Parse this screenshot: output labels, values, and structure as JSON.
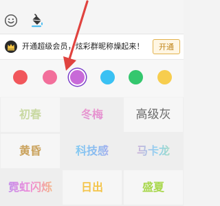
{
  "toolbar": {
    "icons": [
      "emoji-icon",
      "paint-bucket-icon"
    ]
  },
  "banner": {
    "text": "开通超级会员，炫彩群昵称燥起来！",
    "button_label": "开通"
  },
  "swatches": [
    {
      "name": "red",
      "color": "#f1575c",
      "selected": false
    },
    {
      "name": "pink",
      "color": "#f26f9b",
      "selected": false
    },
    {
      "name": "purple",
      "color": "#c86ad8",
      "selected": true
    },
    {
      "name": "blue",
      "color": "#3ac1f3",
      "selected": false
    },
    {
      "name": "green",
      "color": "#34c76e",
      "selected": false
    },
    {
      "name": "yellow",
      "color": "#f7cd4e",
      "selected": false
    }
  ],
  "styles": [
    {
      "label": "初春"
    },
    {
      "label": "冬梅"
    },
    {
      "label": "高级灰"
    },
    {
      "label": "黄昏"
    },
    {
      "label": "科技感"
    },
    {
      "label": "马卡龙"
    },
    {
      "label": "霓虹闪烁"
    },
    {
      "label": "日出"
    },
    {
      "label": "盛夏"
    }
  ],
  "annotation": {
    "color": "#e0433f"
  }
}
